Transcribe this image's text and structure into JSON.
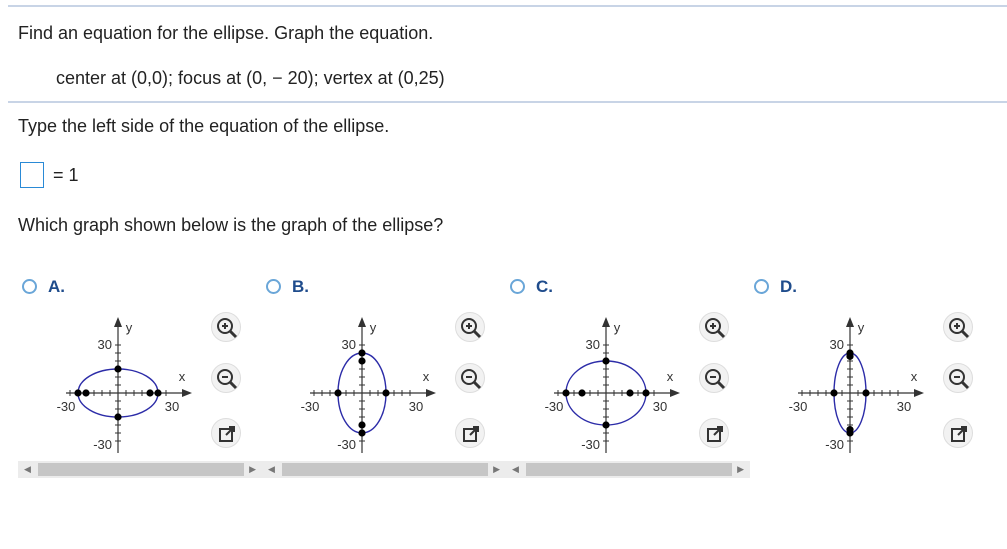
{
  "question": {
    "prompt": "Find an equation for the ellipse.  Graph the equation.",
    "given": "center at (0,0); focus at (0, − 20); vertex at (0,25)",
    "instruction": "Type the left side of the equation of the ellipse.",
    "equals_text": "= 1",
    "graph_question": "Which graph shown below is the graph of the ellipse?"
  },
  "options": [
    {
      "letter": "A.",
      "orientation": "horizontal",
      "a": 25,
      "b": 15,
      "foci_axis": "x"
    },
    {
      "letter": "B.",
      "orientation": "vertical",
      "a": 25,
      "b": 15,
      "foci_axis": "y"
    },
    {
      "letter": "C.",
      "orientation": "horizontal",
      "a": 25,
      "b": 20,
      "foci_axis": "x"
    },
    {
      "letter": "D.",
      "orientation": "vertical",
      "a": 25,
      "b": 10,
      "foci_axis": "y"
    }
  ],
  "axes": {
    "x_label": "x",
    "y_label": "y",
    "x_min_label": "-30",
    "x_max_label": "30",
    "y_min_label": "-30",
    "y_max_label": "30"
  },
  "tools": {
    "zoom_in_icon": "zoom-in-icon",
    "zoom_out_icon": "zoom-out-icon",
    "popout_icon": "popout-icon"
  },
  "colors": {
    "ellipse": "#2c2ca8",
    "accent": "#1f4c8c"
  }
}
